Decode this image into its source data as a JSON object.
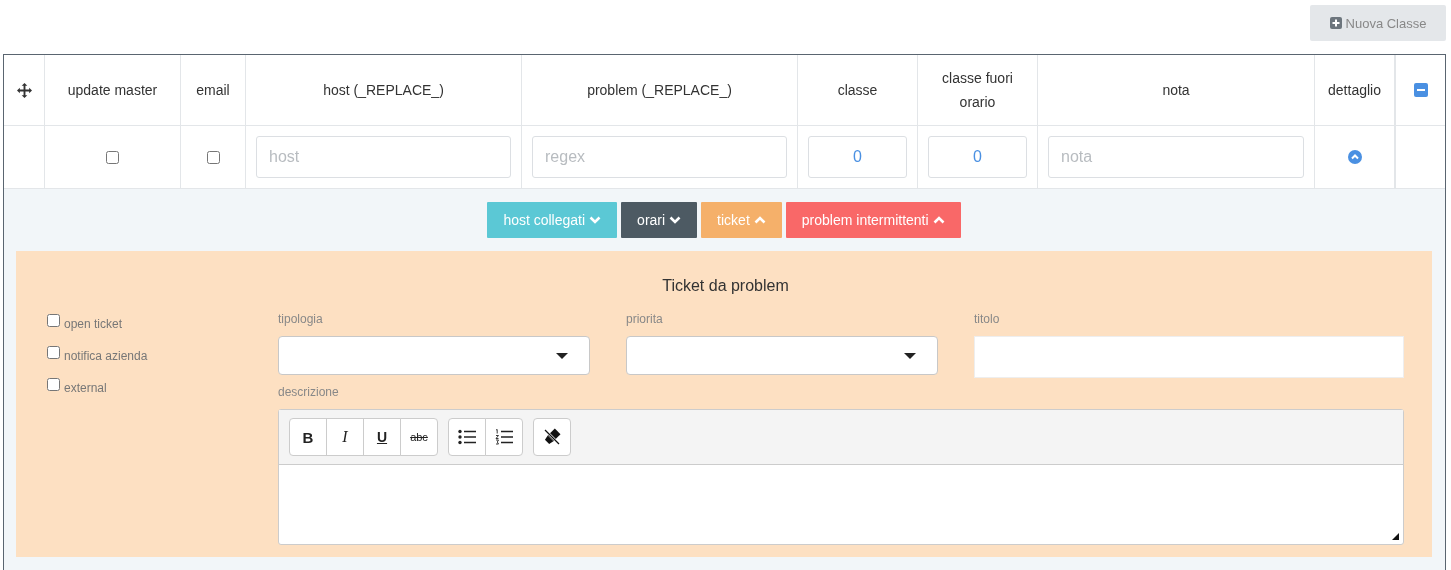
{
  "new_button": {
    "label": "Nuova Classe",
    "disabled": true
  },
  "table": {
    "columns": [
      {
        "kind": "move"
      },
      {
        "kind": "label",
        "label": "update master"
      },
      {
        "kind": "label",
        "label": "email"
      },
      {
        "kind": "label",
        "label": "host (_REPLACE_)"
      },
      {
        "kind": "label",
        "label": "problem (_REPLACE_)"
      },
      {
        "kind": "label",
        "label": "classe"
      },
      {
        "kind": "label",
        "label": "classe fuori orario"
      },
      {
        "kind": "label",
        "label": "nota"
      },
      {
        "kind": "label",
        "label": "dettaglio"
      },
      {
        "kind": "remove"
      }
    ],
    "row": [
      {
        "kind": "empty"
      },
      {
        "kind": "checkbox",
        "checked": false
      },
      {
        "kind": "checkbox",
        "checked": false
      },
      {
        "kind": "input",
        "placeholder": "host"
      },
      {
        "kind": "input",
        "placeholder": "regex"
      },
      {
        "kind": "number",
        "value": "0"
      },
      {
        "kind": "number",
        "value": "0"
      },
      {
        "kind": "input",
        "placeholder": "nota"
      },
      {
        "kind": "expand"
      },
      {
        "kind": "empty"
      }
    ]
  },
  "toggles": [
    {
      "label": "host collegati",
      "color": "#5bc8d5",
      "expanded": false
    },
    {
      "label": "orari",
      "color": "#4d5a63",
      "expanded": false
    },
    {
      "label": "ticket",
      "color": "#f5b06a",
      "expanded": true
    },
    {
      "label": "problem intermittenti",
      "color": "#f96868",
      "expanded": true
    }
  ],
  "ticket_panel": {
    "title": "Ticket da problem",
    "options": [
      {
        "label": "open ticket",
        "checked": false
      },
      {
        "label": "notifica azienda",
        "checked": false
      },
      {
        "label": "external",
        "checked": false
      }
    ],
    "fields": [
      {
        "label": "tipologia",
        "kind": "select"
      },
      {
        "label": "priorita",
        "kind": "select"
      },
      {
        "label": "titolo",
        "kind": "text"
      }
    ],
    "description": {
      "label": "descrizione",
      "groups": [
        {
          "buttons": [
            {
              "kind": "bold",
              "label": "B"
            },
            {
              "kind": "italic",
              "label": "I"
            },
            {
              "kind": "underline",
              "label": "U"
            },
            {
              "kind": "strike",
              "label": "abc"
            }
          ]
        },
        {
          "buttons": [
            {
              "kind": "bullets"
            },
            {
              "kind": "numbers"
            }
          ]
        },
        {
          "buttons": [
            {
              "kind": "eraser"
            }
          ]
        }
      ]
    }
  }
}
